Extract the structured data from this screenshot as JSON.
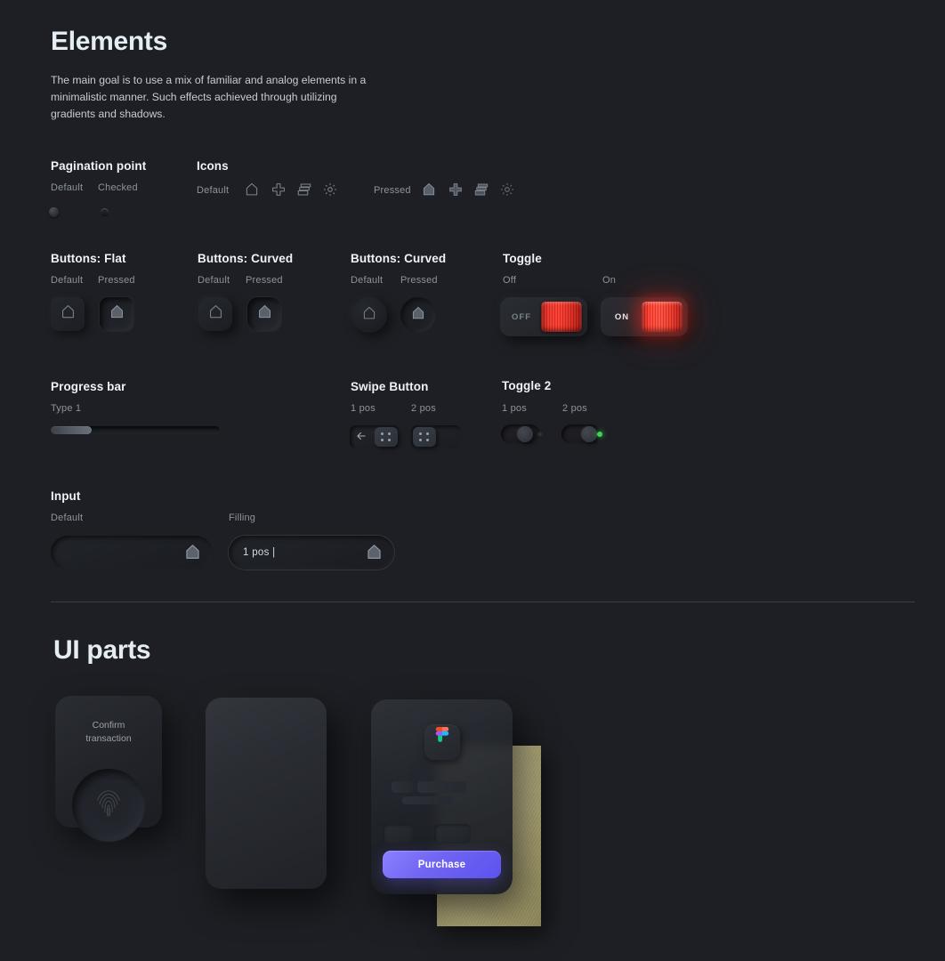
{
  "header": {
    "title": "Elements",
    "description": "The main goal is to use a mix of familiar and analog elements in a minimalistic manner. Such effects achieved through utilizing gradients and shadows."
  },
  "sections": {
    "pagination": {
      "title": "Pagination point",
      "default_label": "Default",
      "checked_label": "Checked"
    },
    "icons": {
      "title": "Icons",
      "default_label": "Default",
      "pressed_label": "Pressed",
      "names": [
        "home-icon",
        "plus-icon",
        "cards-icon",
        "gear-icon"
      ]
    },
    "buttons_flat": {
      "title": "Buttons: Flat",
      "default_label": "Default",
      "pressed_label": "Pressed"
    },
    "buttons_curved_1": {
      "title": "Buttons: Curved",
      "default_label": "Default",
      "pressed_label": "Pressed"
    },
    "buttons_curved_2": {
      "title": "Buttons: Curved",
      "default_label": "Default",
      "pressed_label": "Pressed"
    },
    "toggle": {
      "title": "Toggle",
      "off_label": "Off",
      "on_label": "On",
      "off_text": "OFF",
      "on_text": "ON",
      "accent_color": "#ff3a2c"
    },
    "progress": {
      "title": "Progress bar",
      "type_label": "Type 1",
      "percent": 24
    },
    "swipe": {
      "title": "Swipe Button",
      "pos1_label": "1 pos",
      "pos2_label": "2 pos"
    },
    "toggle2": {
      "title": "Toggle 2",
      "pos1_label": "1 pos",
      "pos2_label": "2 pos",
      "indicator_color": "#3fd255"
    },
    "input": {
      "title": "Input",
      "default_label": "Default",
      "filling_label": "Filling",
      "default_placeholder": "",
      "filling_value": "1 pos |"
    }
  },
  "ui_parts": {
    "title": "UI parts",
    "confirm_card": {
      "title_line1": "Confirm",
      "title_line2": "transaction",
      "sensor": "fingerprint-icon"
    },
    "blank_card": {},
    "purchase_card": {
      "logo": "figma-logo",
      "button_label": "Purchase",
      "accent_color": "#6f64f2"
    }
  }
}
